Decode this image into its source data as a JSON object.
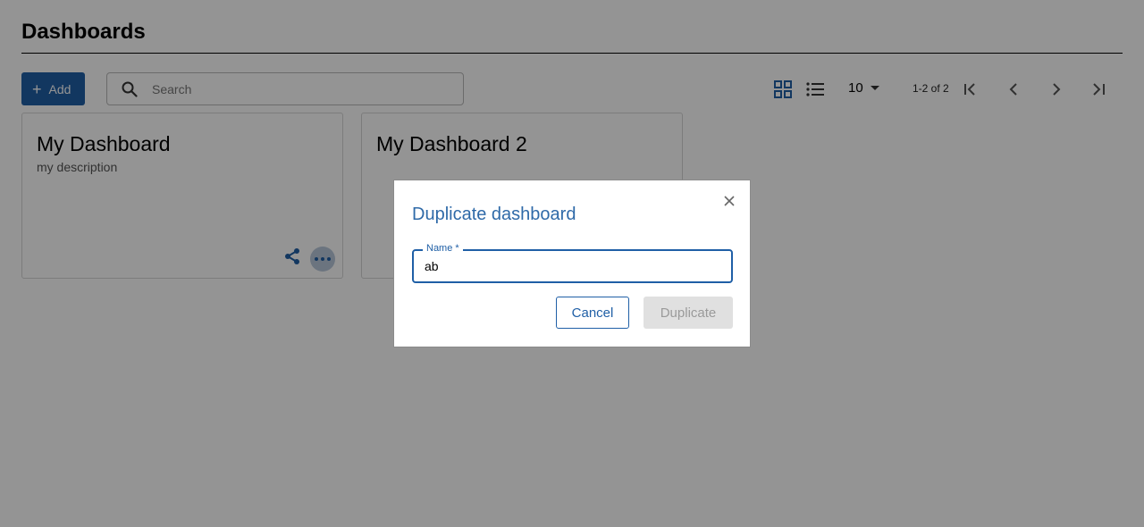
{
  "page": {
    "title": "Dashboards"
  },
  "toolbar": {
    "add_label": "Add",
    "search_placeholder": "Search",
    "page_size": "10",
    "page_count": "1-2 of 2"
  },
  "cards": [
    {
      "title": "My Dashboard",
      "description": "my description"
    },
    {
      "title": "My Dashboard 2",
      "description": ""
    }
  ],
  "dialog": {
    "title": "Duplicate dashboard",
    "field_label": "Name *",
    "field_value": "ab",
    "cancel_label": "Cancel",
    "duplicate_label": "Duplicate"
  },
  "icons": {
    "add": "plus-icon",
    "search": "search-icon",
    "grid_view": "grid-view-icon",
    "list_view": "list-view-icon",
    "first_page": "first-page-icon",
    "prev_page": "chevron-left-icon",
    "next_page": "chevron-right-icon",
    "last_page": "last-page-icon",
    "share": "share-icon",
    "more": "more-icon",
    "close": "close-icon"
  },
  "colors": {
    "primary": "#1f5fa6",
    "dialog_title": "#2f6aa8",
    "disabled_bg": "#e0e0e0",
    "disabled_text": "#9a9a9a"
  }
}
